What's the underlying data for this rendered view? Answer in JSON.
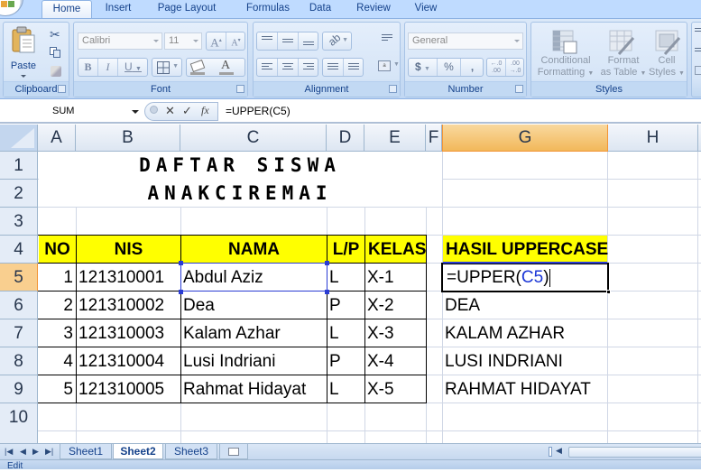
{
  "ribbon": {
    "tabs": [
      {
        "label": "Home",
        "active": true
      },
      {
        "label": "Insert",
        "active": false
      },
      {
        "label": "Page Layout",
        "active": false
      },
      {
        "label": "Formulas",
        "active": false
      },
      {
        "label": "Data",
        "active": false
      },
      {
        "label": "Review",
        "active": false
      },
      {
        "label": "View",
        "active": false
      }
    ],
    "groups": {
      "clipboard": {
        "label": "Clipboard",
        "paste": "Paste"
      },
      "font": {
        "label": "Font",
        "font_name": "Calibri",
        "font_size": "11",
        "bold": "B",
        "italic": "I",
        "underline": "U"
      },
      "alignment": {
        "label": "Alignment"
      },
      "number": {
        "label": "Number",
        "format": "General",
        "currency": "$",
        "percent": "%",
        "comma": ","
      },
      "styles": {
        "label": "Styles",
        "conditional_formatting": [
          "Conditional",
          "Formatting"
        ],
        "format_as_table": [
          "Format",
          "as Table"
        ],
        "cell_styles": [
          "Cell",
          "Styles"
        ]
      }
    }
  },
  "formula_bar": {
    "name_box": "SUM",
    "cancel": "✕",
    "enter": "✓",
    "fx": "fx",
    "formula": "=UPPER(C5)"
  },
  "grid": {
    "columns": [
      "A",
      "B",
      "C",
      "D",
      "E",
      "F",
      "G",
      "H"
    ],
    "selected_column": "G",
    "rows": [
      "1",
      "2",
      "3",
      "4",
      "5",
      "6",
      "7",
      "8",
      "9",
      "10"
    ],
    "selected_row": "5",
    "title_line1": "DAFTAR SISWA",
    "title_line2": "ANAKCIREMAI",
    "headers": {
      "no": "NO",
      "nis": "NIS",
      "nama": "NAMA",
      "lp": "L/P",
      "kelas": "KELAS",
      "hasil": "HASIL UPPERCASE"
    },
    "records": [
      {
        "no": "1",
        "nis": "121310001",
        "nama": "Abdul Aziz",
        "lp": "L",
        "kelas": "X-1",
        "hasil": ""
      },
      {
        "no": "2",
        "nis": "121310002",
        "nama": "Dea",
        "lp": "P",
        "kelas": "X-2",
        "hasil": "DEA"
      },
      {
        "no": "3",
        "nis": "121310003",
        "nama": "Kalam Azhar",
        "lp": "L",
        "kelas": "X-3",
        "hasil": "KALAM AZHAR"
      },
      {
        "no": "4",
        "nis": "121310004",
        "nama": "Lusi Indriani",
        "lp": "P",
        "kelas": "X-4",
        "hasil": "LUSI INDRIANI"
      },
      {
        "no": "5",
        "nis": "121310005",
        "nama": "Rahmat Hidayat",
        "lp": "L",
        "kelas": "X-5",
        "hasil": "RAHMAT HIDAYAT"
      }
    ],
    "editing_cell": {
      "prefix": "=UPPER(",
      "ref": "C5",
      "suffix": ")"
    }
  },
  "sheets": [
    {
      "label": "Sheet1",
      "active": false
    },
    {
      "label": "Sheet2",
      "active": true
    },
    {
      "label": "Sheet3",
      "active": false
    }
  ],
  "status": {
    "mode": "Edit"
  },
  "colors": {
    "header_fill": "#ffff00",
    "ref_blue": "#1a36d6",
    "selection_orange": "#f29536"
  }
}
